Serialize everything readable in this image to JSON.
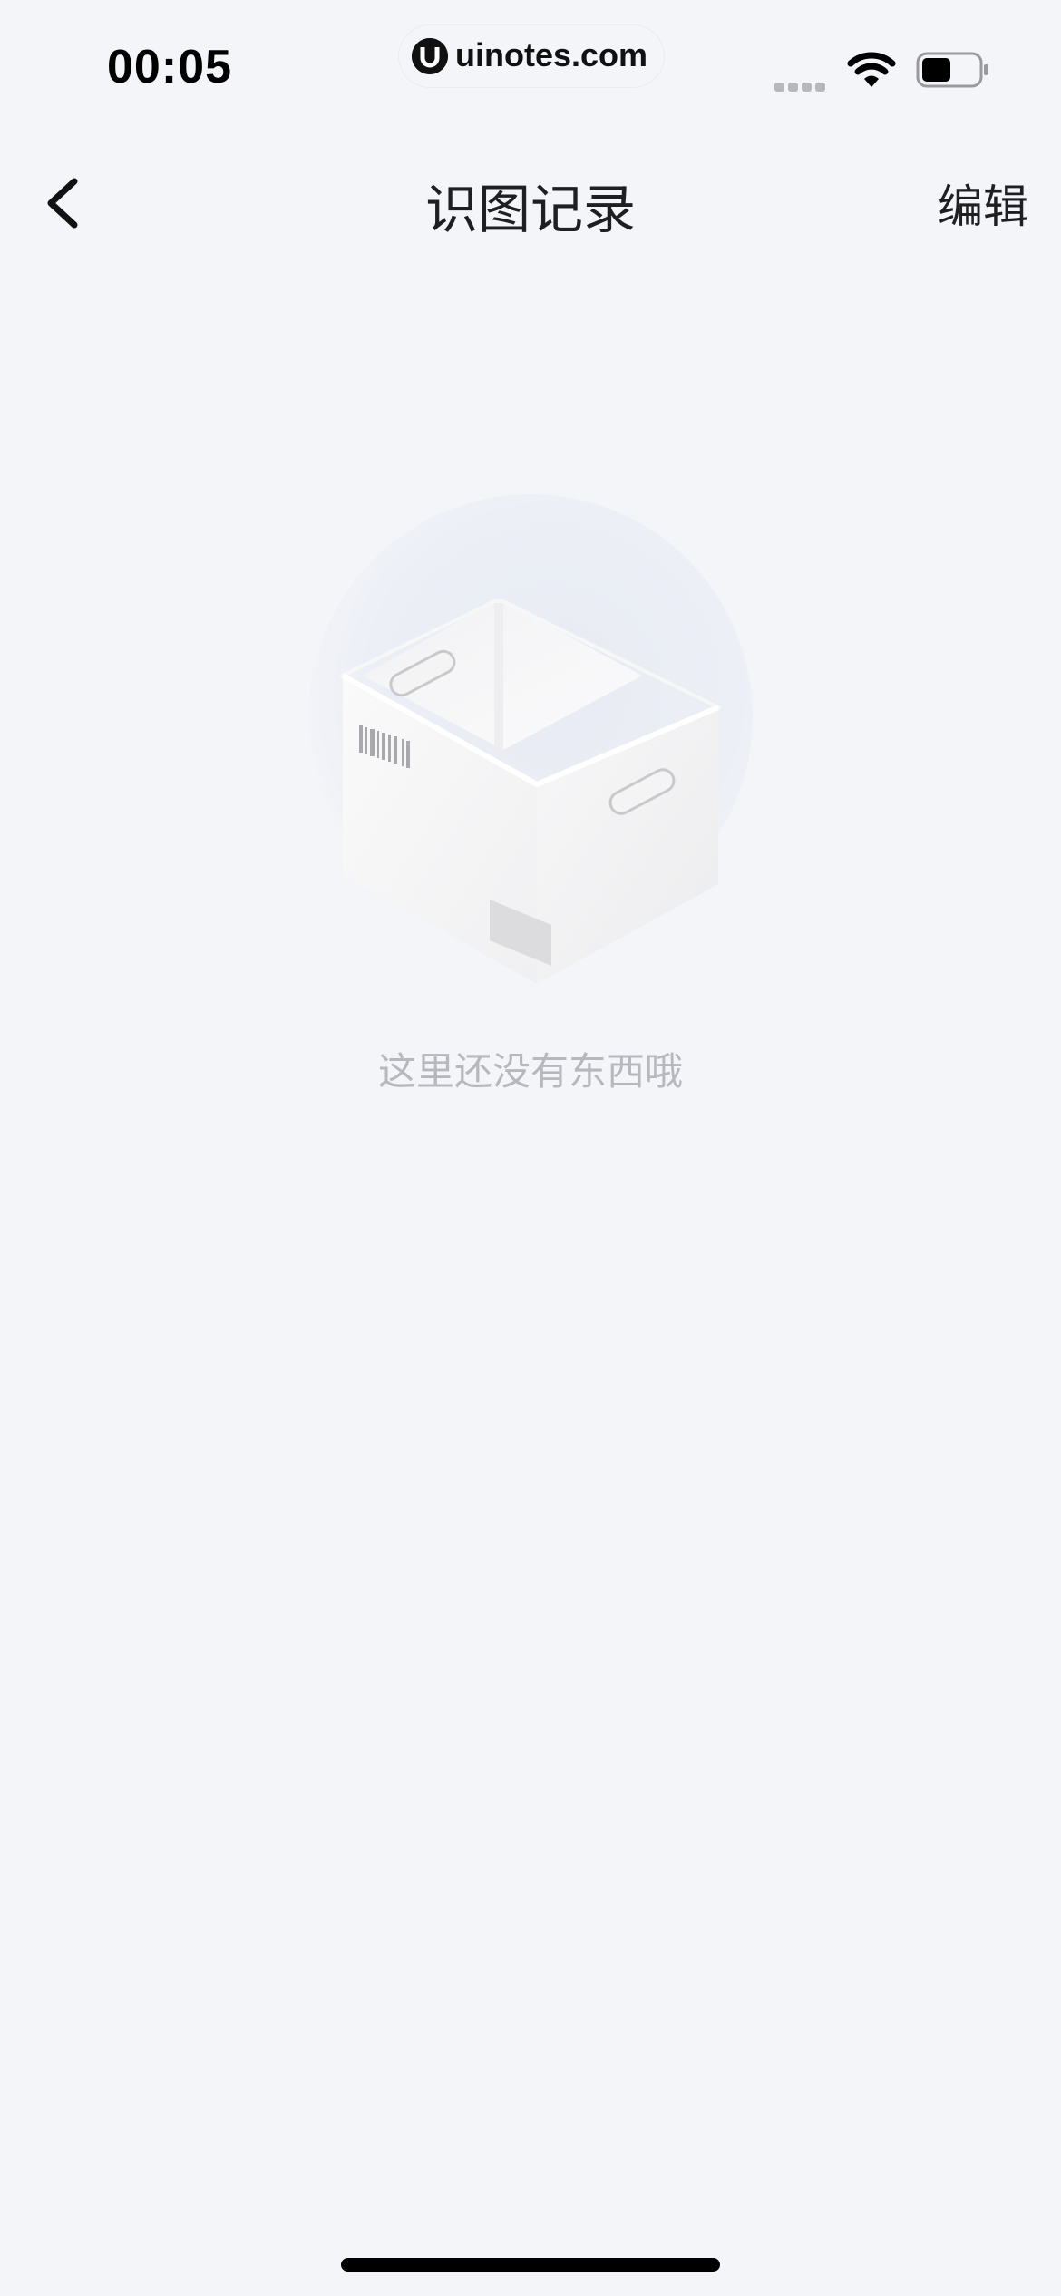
{
  "status_bar": {
    "time": "00:05",
    "watermark": "uinotes.com",
    "icons": [
      "signal-icon",
      "wifi-icon",
      "battery-icon"
    ]
  },
  "nav": {
    "back_icon": "chevron-left-icon",
    "title": "识图记录",
    "edit_label": "编辑"
  },
  "empty_state": {
    "illustration": "empty-box-icon",
    "message": "这里还没有东西哦"
  },
  "colors": {
    "background": "#f4f5f9",
    "title_text": "#1f1f21",
    "empty_text": "#b6b8be"
  }
}
